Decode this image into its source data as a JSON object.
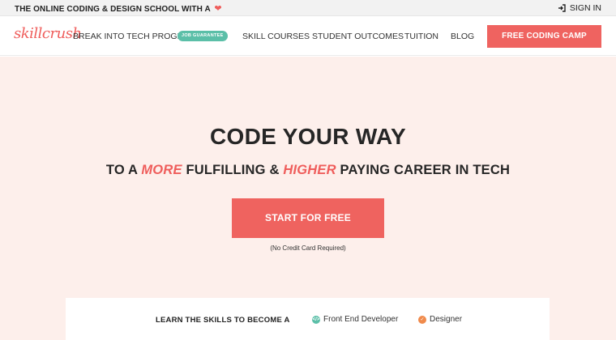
{
  "topbar": {
    "tagline": "THE ONLINE CODING & DESIGN SCHOOL WITH A",
    "heart": "❤",
    "signin": "SIGN IN"
  },
  "nav": {
    "logo": "skillcrush",
    "items": [
      "BREAK INTO TECH PROGRAM",
      "SKILL COURSES",
      "STUDENT OUTCOMES",
      "TUITION",
      "BLOG"
    ],
    "badge": "JOB GUARANTEE",
    "cta": "FREE CODING CAMP"
  },
  "hero": {
    "title": "CODE YOUR WAY",
    "subtitle_pre": "TO A ",
    "subtitle_more": "MORE",
    "subtitle_mid": " FULFILLING & ",
    "subtitle_higher": "HIGHER",
    "subtitle_post": " PAYING CAREER IN TECH",
    "button": "START FOR FREE",
    "note": "(No Credit Card Required)"
  },
  "panel": {
    "learn": "LEARN THE SKILLS TO BECOME A",
    "roles": [
      {
        "label": "Front End Developer",
        "icon": "code-icon",
        "color": "#5bbfa8"
      },
      {
        "label": "Designer",
        "icon": "check-icon",
        "color": "#f08a4b"
      }
    ]
  }
}
